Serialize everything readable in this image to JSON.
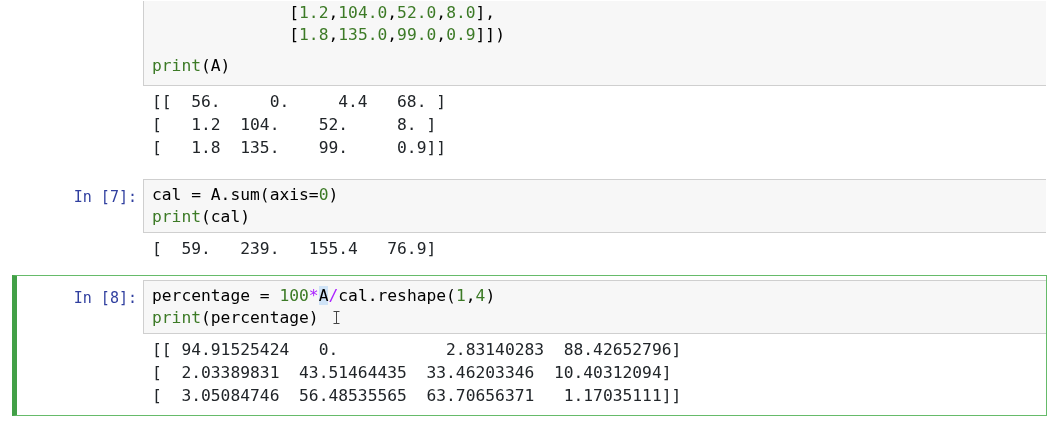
{
  "cells": [
    {
      "selected": false,
      "input_lines": [
        {
          "kind": "code",
          "tokens": [
            {
              "kind": "plain",
              "text": "              ["
            },
            {
              "kind": "number",
              "text": "1.2"
            },
            {
              "kind": "plain",
              "text": ","
            },
            {
              "kind": "number",
              "text": "104.0"
            },
            {
              "kind": "plain",
              "text": ","
            },
            {
              "kind": "number",
              "text": "52.0"
            },
            {
              "kind": "plain",
              "text": ","
            },
            {
              "kind": "number",
              "text": "8.0"
            },
            {
              "kind": "plain",
              "text": "],"
            }
          ]
        },
        {
          "kind": "code",
          "tokens": [
            {
              "kind": "plain",
              "text": "              ["
            },
            {
              "kind": "number",
              "text": "1.8"
            },
            {
              "kind": "plain",
              "text": ","
            },
            {
              "kind": "number",
              "text": "135.0"
            },
            {
              "kind": "plain",
              "text": ","
            },
            {
              "kind": "number",
              "text": "99.0"
            },
            {
              "kind": "plain",
              "text": ","
            },
            {
              "kind": "number",
              "text": "0.9"
            },
            {
              "kind": "plain",
              "text": "]])"
            }
          ]
        },
        {
          "kind": "blank"
        },
        {
          "kind": "code",
          "tokens": [
            {
              "kind": "builtin",
              "text": "print"
            },
            {
              "kind": "plain",
              "text": "(A)"
            }
          ]
        }
      ],
      "output_lines": [
        "[[  56.     0.     4.4   68. ]",
        "[   1.2  104.    52.     8. ]",
        "[   1.8  135.    99.     0.9]]"
      ]
    },
    {
      "prompt": "In [7]:",
      "selected": false,
      "input_lines": [
        {
          "kind": "code",
          "tokens": [
            {
              "kind": "plain",
              "text": "cal = A.sum(axis="
            },
            {
              "kind": "number",
              "text": "0"
            },
            {
              "kind": "plain",
              "text": ")"
            }
          ]
        },
        {
          "kind": "code",
          "tokens": [
            {
              "kind": "builtin",
              "text": "print"
            },
            {
              "kind": "plain",
              "text": "(cal)"
            }
          ]
        }
      ],
      "output_lines": [
        "[  59.   239.   155.4   76.9]"
      ]
    },
    {
      "prompt": "In [8]:",
      "selected": true,
      "input_lines": [
        {
          "kind": "code",
          "tokens": [
            {
              "kind": "plain",
              "text": "percentage = "
            },
            {
              "kind": "number",
              "text": "100"
            },
            {
              "kind": "operator",
              "text": "*"
            },
            {
              "kind": "highlight",
              "text": "A"
            },
            {
              "kind": "operator",
              "text": "/"
            },
            {
              "kind": "plain",
              "text": "cal.reshape("
            },
            {
              "kind": "number",
              "text": "1"
            },
            {
              "kind": "plain",
              "text": ","
            },
            {
              "kind": "number",
              "text": "4"
            },
            {
              "kind": "plain",
              "text": ")"
            }
          ]
        },
        {
          "kind": "code",
          "tokens": [
            {
              "kind": "builtin",
              "text": "print"
            },
            {
              "kind": "plain",
              "text": "(percentage)"
            }
          ]
        }
      ],
      "output_lines": [
        "[[ 94.91525424   0.           2.83140283  88.42652796]",
        "[  2.03389831  43.51464435  33.46203346  10.40312094]",
        "[  3.05084746  56.48535565  63.70656371   1.17035111]]"
      ]
    }
  ]
}
